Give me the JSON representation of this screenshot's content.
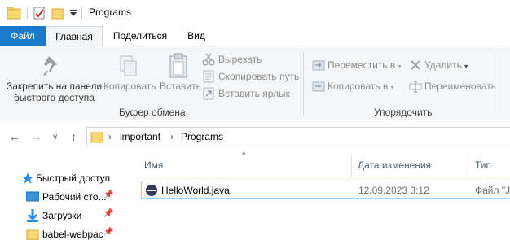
{
  "title_bar": {
    "title": "Programs",
    "quick_access_icons": [
      "folder-icon",
      "properties-icon",
      "new-folder-icon",
      "customize-chevron-icon"
    ]
  },
  "ribbon_tabs": [
    {
      "label": "Файл",
      "active": false
    },
    {
      "label": "Главная",
      "active": true
    },
    {
      "label": "Поделиться",
      "active": false
    },
    {
      "label": "Вид",
      "active": false
    }
  ],
  "ribbon": {
    "clipboard": {
      "pin_line1": "Закрепить на панели",
      "pin_line2": "быстрого доступа",
      "copy": "Копировать",
      "paste": "Вставить",
      "cut": "Вырезать",
      "copy_path": "Скопировать путь",
      "paste_shortcut": "Вставить ярлык",
      "group_label": "Буфер обмена"
    },
    "organize": {
      "move_to": "Переместить в",
      "copy_to": "Копировать в",
      "delete": "Удалить",
      "rename": "Переименовать",
      "group_label": "Упорядочить"
    }
  },
  "address_bar": {
    "crumbs": [
      "important",
      "Programs"
    ]
  },
  "navigation_pane": {
    "items": [
      {
        "label": "Быстрый доступ",
        "icon": "star-icon",
        "pinned": false
      },
      {
        "label": "Рабочий сто...",
        "icon": "desktop-icon",
        "pinned": true
      },
      {
        "label": "Загрузки",
        "icon": "download-icon",
        "pinned": true
      },
      {
        "label": "babel-webpac",
        "icon": "folder-icon",
        "pinned": true
      }
    ]
  },
  "file_list": {
    "columns": [
      "Имя",
      "Дата изменения",
      "Тип"
    ],
    "rows": [
      {
        "name": "HelloWorld.java",
        "modified": "12.09.2023 3:12",
        "type": "Файл \"J"
      }
    ]
  },
  "colors": {
    "file_tab": "#1979ca",
    "selection_border": "#99d1ff",
    "ribbon_bg": "#f5f6f7",
    "column_header_text": "#4c607a"
  }
}
